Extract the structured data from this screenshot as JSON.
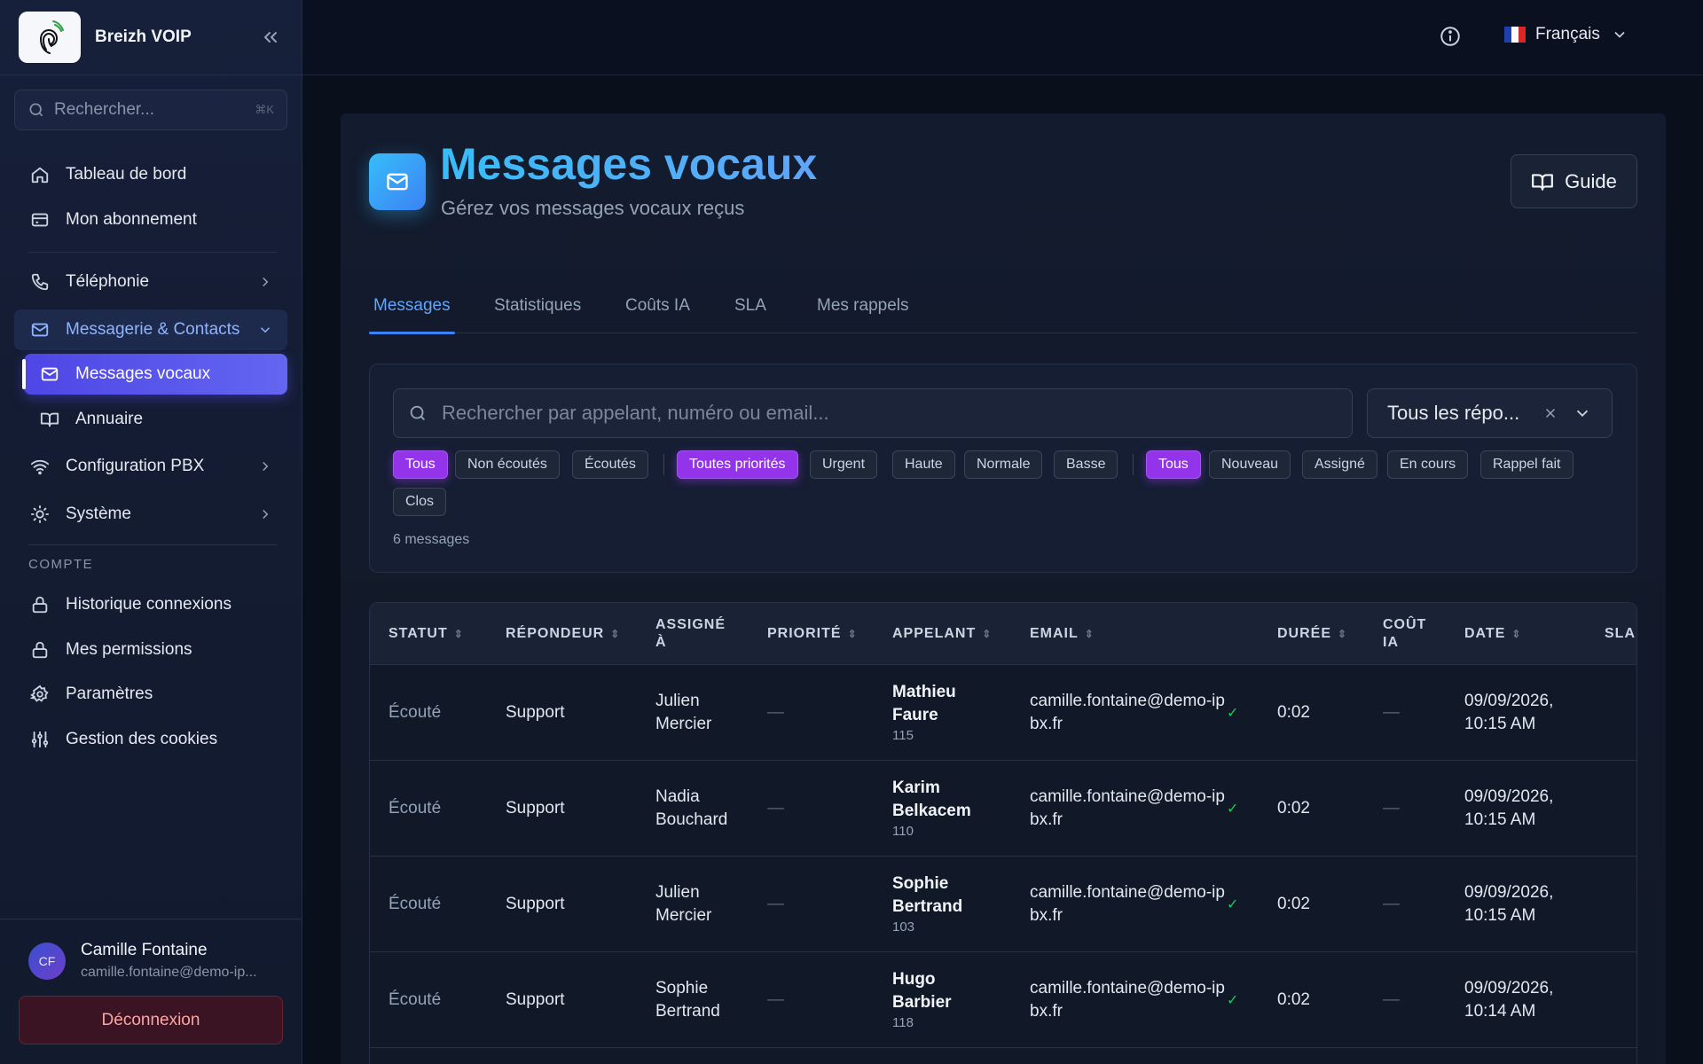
{
  "brand": {
    "name": "Breizh VOIP"
  },
  "sidebar": {
    "search_placeholder": "Rechercher...",
    "search_shortcut": "⌘K",
    "items": {
      "dashboard": "Tableau de bord",
      "subscription": "Mon abonnement",
      "telephony": "Téléphonie",
      "messaging": "Messagerie & Contacts",
      "voicemail": "Messages vocaux",
      "directory": "Annuaire",
      "pbx": "Configuration PBX",
      "system": "Système"
    },
    "account_section": "COMPTE",
    "account_items": {
      "login_history": "Historique connexions",
      "permissions": "Mes permissions",
      "settings": "Paramètres",
      "cookies": "Gestion des cookies"
    },
    "user": {
      "initials": "CF",
      "name": "Camille Fontaine",
      "email": "camille.fontaine@demo-ip..."
    },
    "logout_label": "Déconnexion"
  },
  "topbar": {
    "language": "Français"
  },
  "page": {
    "title": "Messages vocaux",
    "subtitle": "Gérez vos messages vocaux reçus",
    "guide_label": "Guide"
  },
  "tabs": [
    "Messages",
    "Statistiques",
    "Coûts IA",
    "SLA",
    "Mes rappels"
  ],
  "filters": {
    "search_placeholder": "Rechercher par appelant, numéro ou email...",
    "responder_select": "Tous les répo...",
    "listen_chips": [
      "Tous",
      "Non écoutés",
      "Écoutés"
    ],
    "priority_chips": [
      "Toutes priorités",
      "Urgent",
      "Haute",
      "Normale",
      "Basse"
    ],
    "status_chips": [
      "Tous",
      "Nouveau",
      "Assigné",
      "En cours",
      "Rappel fait",
      "Clos"
    ],
    "count_label": "6 messages"
  },
  "table": {
    "headers": {
      "status": "STATUT",
      "responder": "RÉPONDEUR",
      "assigned": "ASSIGNÉ À",
      "priority": "PRIORITÉ",
      "caller": "APPELANT",
      "email": "EMAIL",
      "duration": "DURÉE",
      "cost": "COÛT IA",
      "date": "DATE",
      "sla": "SLA"
    },
    "rows": [
      {
        "status": "Écouté",
        "responder": "Support",
        "assigned": "Julien Mercier",
        "priority": "—",
        "caller_name": "Mathieu Faure",
        "caller_ext": "115",
        "email": "camille.fontaine@demo-ipbx.fr",
        "email_check": "✓",
        "duration": "0:02",
        "cost": "—",
        "date": "09/09/2026, 10:15 AM"
      },
      {
        "status": "Écouté",
        "responder": "Support",
        "assigned": "Nadia Bouchard",
        "priority": "—",
        "caller_name": "Karim Belkacem",
        "caller_ext": "110",
        "email": "camille.fontaine@demo-ipbx.fr",
        "email_check": "✓",
        "duration": "0:02",
        "cost": "—",
        "date": "09/09/2026, 10:15 AM"
      },
      {
        "status": "Écouté",
        "responder": "Support",
        "assigned": "Julien Mercier",
        "priority": "—",
        "caller_name": "Sophie Bertrand",
        "caller_ext": "103",
        "email": "camille.fontaine@demo-ipbx.fr",
        "email_check": "✓",
        "duration": "0:02",
        "cost": "—",
        "date": "09/09/2026, 10:15 AM"
      },
      {
        "status": "Écouté",
        "responder": "Support",
        "assigned": "Sophie Bertrand",
        "priority": "—",
        "caller_name": "Hugo Barbier",
        "caller_ext": "118",
        "email": "camille.fontaine@demo-ipbx.fr",
        "email_check": "✓",
        "duration": "0:02",
        "cost": "—",
        "date": "09/09/2026, 10:14 AM"
      }
    ]
  }
}
